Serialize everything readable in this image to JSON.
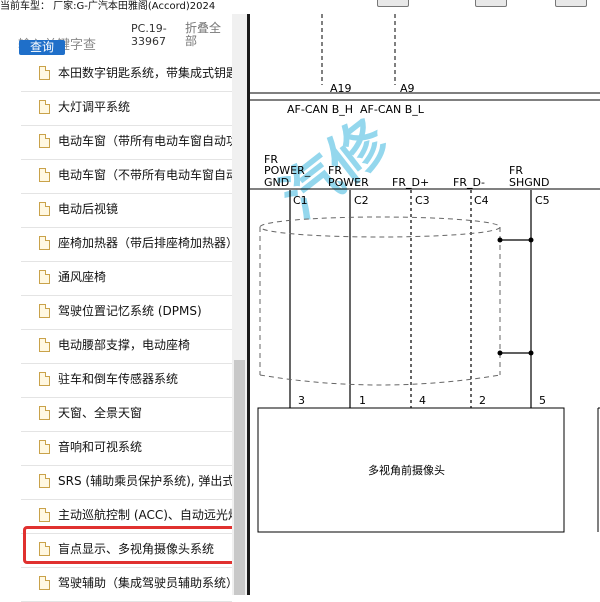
{
  "title_bar": {
    "text": "当前车型：  厂家:G-广汽本田雅阁(Accord)2024"
  },
  "search": {
    "placeholder": "输入关键字查",
    "button_label": "查询"
  },
  "doc_code": "PC.19-33967",
  "collapse_all_label": "折叠全部",
  "tree_items": [
    {
      "label": "本田数字钥匙系统，带集成式钥匙"
    },
    {
      "label": "大灯调平系统"
    },
    {
      "label": "电动车窗（带所有电动车窗自动功能）"
    },
    {
      "label": "电动车窗（不带所有电动车窗自动功能）"
    },
    {
      "label": "电动后视镜"
    },
    {
      "label": "座椅加热器（带后排座椅加热器）"
    },
    {
      "label": "通风座椅"
    },
    {
      "label": "驾驶位置记忆系统 (DPMS)"
    },
    {
      "label": "电动腰部支撑，电动座椅"
    },
    {
      "label": "驻车和倒车传感器系统"
    },
    {
      "label": "天窗、全景天窗"
    },
    {
      "label": "音响和可视系统"
    },
    {
      "label": "SRS (辅助乘员保护系统), 弹出式发动机盖"
    },
    {
      "label": "主动巡航控制 (ACC)、自动远光灯"
    },
    {
      "label": "盲点显示、多视角摄像头系统"
    },
    {
      "label": "驾驶辅助（集成驾驶员辅助系统）"
    }
  ],
  "highlight_color": "#e0312f",
  "diagram": {
    "top_pins": [
      "A19",
      "A9"
    ],
    "can_labels": [
      "AF-CAN B_H",
      "AF-CAN B_L"
    ],
    "signals": [
      {
        "line1": "FR",
        "line2": "POWER_",
        "line3": "GND",
        "conn": "C1",
        "pin": "3"
      },
      {
        "line1": "FR",
        "line2": "POWER",
        "line3": "",
        "conn": "C2",
        "pin": "1"
      },
      {
        "line1": "",
        "line2": "FR_D+",
        "line3": "",
        "conn": "C3",
        "pin": "4"
      },
      {
        "line1": "",
        "line2": "FR_D-",
        "line3": "",
        "conn": "C4",
        "pin": "2"
      },
      {
        "line1": "FR",
        "line2": "SHGND",
        "line3": "",
        "conn": "C5",
        "pin": "5"
      }
    ],
    "component_label": "多视角前摄像头"
  }
}
